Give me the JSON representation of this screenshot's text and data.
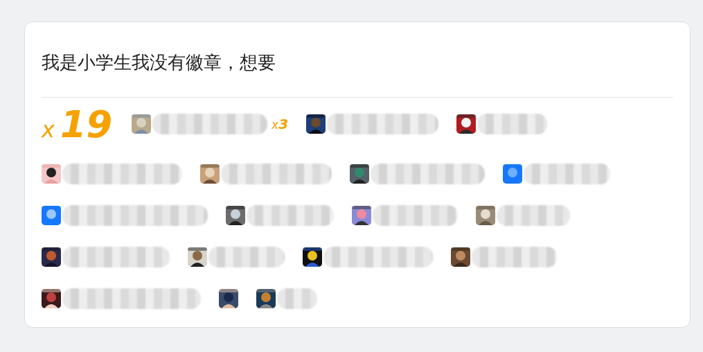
{
  "title": "我是小学生我没有徽章，想要",
  "total": {
    "prefix": "x",
    "count": "19"
  },
  "rows": [
    [
      {
        "kind": "named",
        "count": {
          "prefix": "x",
          "value": "3"
        }
      },
      {
        "kind": "named"
      },
      {
        "kind": "named"
      }
    ],
    [
      {
        "kind": "named"
      },
      {
        "kind": "named"
      },
      {
        "kind": "named"
      },
      {
        "kind": "named"
      }
    ],
    [
      {
        "kind": "named"
      },
      {
        "kind": "named"
      },
      {
        "kind": "named"
      },
      {
        "kind": "named"
      }
    ],
    [
      {
        "kind": "named"
      },
      {
        "kind": "named"
      },
      {
        "kind": "named"
      },
      {
        "kind": "named"
      }
    ],
    [
      {
        "kind": "named"
      },
      {
        "kind": "avatar-only"
      },
      {
        "kind": "named"
      }
    ]
  ]
}
